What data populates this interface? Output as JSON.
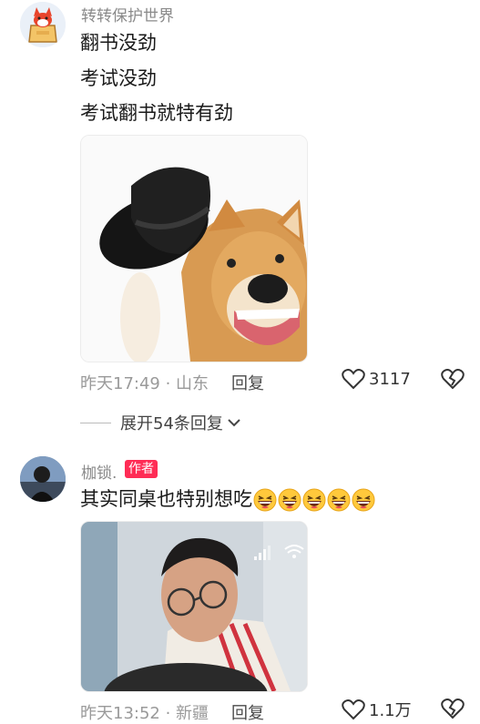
{
  "comments": [
    {
      "username": "转转保护世界",
      "lines": [
        "翻书没劲",
        "考试没劲",
        "考试翻书就特有劲"
      ],
      "time_location": "昨天17:49 · 山东",
      "reply_label": "回复",
      "likes": "3117",
      "expand_label": "展开54条回复"
    },
    {
      "username": "枷锁.",
      "badge": "作者",
      "text": "其实同桌也特别想吃",
      "emoji_count": 5,
      "time_location": "昨天13:52 · 新疆",
      "reply_label": "回复",
      "likes": "1.1万"
    }
  ],
  "colors": {
    "accent": "#ff2c55",
    "meta": "#9a9a9a"
  },
  "icons": [
    "heart-icon",
    "broken-heart-icon",
    "chevron-down-icon",
    "laughing-emoji-icon"
  ]
}
